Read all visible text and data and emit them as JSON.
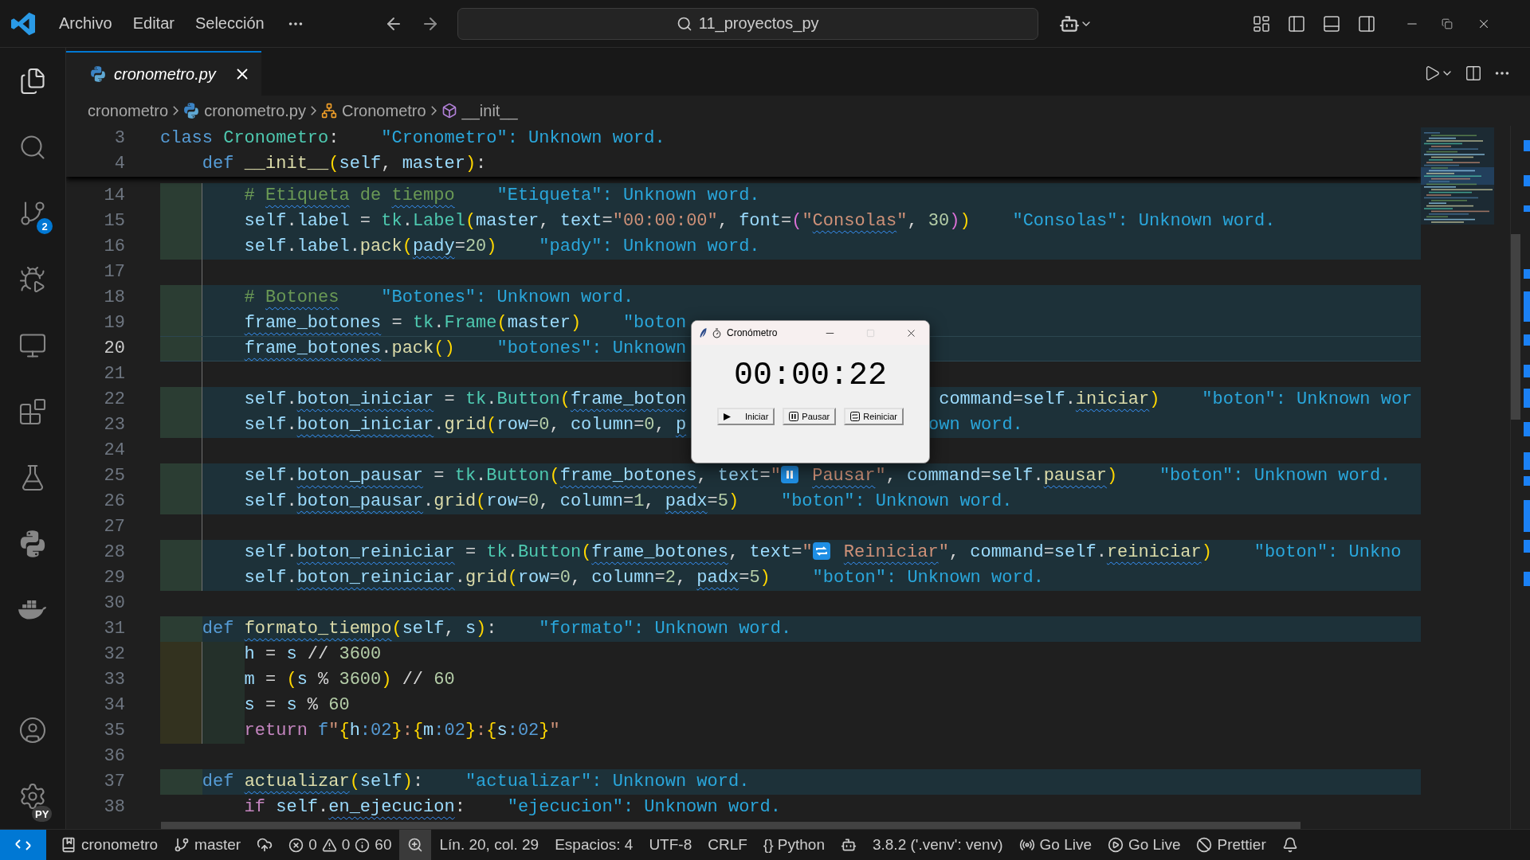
{
  "title_bar": {
    "menus": [
      "Archivo",
      "Editar",
      "Selección"
    ],
    "search": "11_proyectos_py"
  },
  "activity_bar": {
    "top": [
      {
        "kind": "files",
        "selected": true
      },
      {
        "kind": "search",
        "selected": false
      },
      {
        "kind": "source-control",
        "badge": "2",
        "selected": false
      },
      {
        "kind": "run-debug",
        "selected": false
      },
      {
        "kind": "remote",
        "selected": false
      },
      {
        "kind": "extensions",
        "selected": false
      },
      {
        "kind": "testing",
        "selected": false
      },
      {
        "kind": "python",
        "selected": false
      },
      {
        "kind": "docker",
        "selected": false
      }
    ],
    "bottom": [
      {
        "kind": "account",
        "selected": false
      },
      {
        "kind": "settings",
        "badge": "PY",
        "selected": false
      }
    ]
  },
  "tabs": [
    {
      "label": "cronometro.py",
      "selected": true
    }
  ],
  "breadcrumbs": [
    {
      "text": "cronometro"
    },
    {
      "text": "cronometro.py",
      "kind": "file"
    },
    {
      "text": "Cronometro",
      "kind": "class"
    },
    {
      "text": "__init__",
      "kind": "method"
    }
  ],
  "editor": {
    "sticky": [
      {
        "number": "3",
        "tokens": [
          {
            "kind": "kw",
            "text": "class "
          },
          {
            "kind": "cls",
            "text": "Cronometro"
          },
          {
            "kind": "op",
            "text": ":"
          }
        ],
        "diagnostic": "\"Cronometro\": Unknown word."
      },
      {
        "number": "4",
        "tokens": [
          {
            "kind": "kw",
            "text": "    def "
          },
          {
            "kind": "fn",
            "text": "__init__"
          },
          {
            "kind": "br1",
            "text": "("
          },
          {
            "kind": "var",
            "text": "self"
          },
          {
            "kind": "op",
            "text": ", "
          },
          {
            "kind": "var",
            "text": "master"
          },
          {
            "kind": "br1",
            "text": ")"
          },
          {
            "kind": "op",
            "text": ":"
          }
        ]
      }
    ],
    "lines": [
      {
        "number": "14",
        "kind": "block",
        "guide": true,
        "tokens": [
          {
            "kind": "com",
            "text": "        # "
          },
          {
            "kind": "com",
            "text": "Etiqueta",
            "wavy": true
          },
          {
            "kind": "com",
            "text": " de "
          },
          {
            "kind": "com",
            "text": "tiempo",
            "wavy": true
          }
        ],
        "diagnostic": "\"Etiqueta\": Unknown word."
      },
      {
        "number": "15",
        "kind": "block",
        "guide": true,
        "tokens": [
          {
            "kind": "var",
            "text": "        self"
          },
          {
            "kind": "op",
            "text": "."
          },
          {
            "kind": "var",
            "text": "label"
          },
          {
            "kind": "op",
            "text": " = "
          },
          {
            "kind": "cls",
            "text": "tk"
          },
          {
            "kind": "op",
            "text": "."
          },
          {
            "kind": "cls",
            "text": "Label"
          },
          {
            "kind": "br1",
            "text": "("
          },
          {
            "kind": "var",
            "text": "master"
          },
          {
            "kind": "op",
            "text": ", "
          },
          {
            "kind": "var",
            "text": "text"
          },
          {
            "kind": "op",
            "text": "="
          },
          {
            "kind": "str",
            "text": "\"00:00:00\""
          },
          {
            "kind": "op",
            "text": ", "
          },
          {
            "kind": "var",
            "text": "font"
          },
          {
            "kind": "op",
            "text": "="
          },
          {
            "kind": "br2",
            "text": "("
          },
          {
            "kind": "str",
            "text": "\""
          },
          {
            "kind": "str",
            "text": "Consolas",
            "wavy": true
          },
          {
            "kind": "str",
            "text": "\""
          },
          {
            "kind": "op",
            "text": ", "
          },
          {
            "kind": "num",
            "text": "30"
          },
          {
            "kind": "br2",
            "text": ")"
          },
          {
            "kind": "br1",
            "text": ")"
          }
        ],
        "diagnostic": "\"Consolas\": Unknown word."
      },
      {
        "number": "16",
        "kind": "block",
        "guide": true,
        "tokens": [
          {
            "kind": "var",
            "text": "        self"
          },
          {
            "kind": "op",
            "text": "."
          },
          {
            "kind": "var",
            "text": "label"
          },
          {
            "kind": "op",
            "text": "."
          },
          {
            "kind": "fn",
            "text": "pack"
          },
          {
            "kind": "br1",
            "text": "("
          },
          {
            "kind": "var",
            "text": "pady",
            "wavy": true
          },
          {
            "kind": "op",
            "text": "="
          },
          {
            "kind": "num",
            "text": "20"
          },
          {
            "kind": "br1",
            "text": ")"
          }
        ],
        "diagnostic": "\"pady\": Unknown word."
      },
      {
        "number": "17",
        "kind": "plain",
        "guide": true
      },
      {
        "number": "18",
        "kind": "block",
        "guide": true,
        "tokens": [
          {
            "kind": "com",
            "text": "        # "
          },
          {
            "kind": "com",
            "text": "Botones",
            "wavy": true
          }
        ],
        "diagnostic": "\"Botones\": Unknown word."
      },
      {
        "number": "19",
        "kind": "block",
        "guide": true,
        "tokens": [
          {
            "kind": "var",
            "text": "        frame_botones",
            "wavy": true
          },
          {
            "kind": "op",
            "text": " = "
          },
          {
            "kind": "cls",
            "text": "tk"
          },
          {
            "kind": "op",
            "text": "."
          },
          {
            "kind": "cls",
            "text": "Frame"
          },
          {
            "kind": "br1",
            "text": "("
          },
          {
            "kind": "var",
            "text": "master"
          },
          {
            "kind": "br1",
            "text": ")"
          }
        ],
        "diagnostic": "\"boton"
      },
      {
        "number": "20",
        "kind": "block",
        "guide": true,
        "current": true,
        "tokens": [
          {
            "kind": "var",
            "text": "        frame_botones",
            "wavy": true
          },
          {
            "kind": "op",
            "text": "."
          },
          {
            "kind": "fn",
            "text": "pack"
          },
          {
            "kind": "br1",
            "text": "()"
          }
        ],
        "diagnostic": "\"botones\": Unknown"
      },
      {
        "number": "21",
        "kind": "plain",
        "guide": true
      },
      {
        "number": "22",
        "kind": "block",
        "guide": true,
        "tokens": [
          {
            "kind": "var",
            "text": "        self"
          },
          {
            "kind": "op",
            "text": "."
          },
          {
            "kind": "var",
            "text": "boton_iniciar",
            "wavy": true
          },
          {
            "kind": "op",
            "text": " = "
          },
          {
            "kind": "cls",
            "text": "tk"
          },
          {
            "kind": "op",
            "text": "."
          },
          {
            "kind": "cls",
            "text": "Button"
          },
          {
            "kind": "br1",
            "text": "("
          },
          {
            "kind": "var",
            "text": "frame_boton",
            "wavy": true
          }
        ],
        "tail": {
          "tokens": [
            {
              "kind": "var",
              "text": " command"
            },
            {
              "kind": "op",
              "text": "="
            },
            {
              "kind": "var",
              "text": "self"
            },
            {
              "kind": "op",
              "text": "."
            },
            {
              "kind": "fn",
              "text": "iniciar",
              "wavy": true
            },
            {
              "kind": "br1",
              "text": ")"
            }
          ],
          "diagnostic": "\"boton\": Unknown wor"
        }
      },
      {
        "number": "23",
        "kind": "block",
        "guide": true,
        "tokens": [
          {
            "kind": "var",
            "text": "        self"
          },
          {
            "kind": "op",
            "text": "."
          },
          {
            "kind": "var",
            "text": "boton_iniciar",
            "wavy": true
          },
          {
            "kind": "op",
            "text": "."
          },
          {
            "kind": "fn",
            "text": "grid"
          },
          {
            "kind": "br1",
            "text": "("
          },
          {
            "kind": "var",
            "text": "row"
          },
          {
            "kind": "op",
            "text": "="
          },
          {
            "kind": "num",
            "text": "0"
          },
          {
            "kind": "op",
            "text": ", "
          },
          {
            "kind": "var",
            "text": "column"
          },
          {
            "kind": "op",
            "text": "="
          },
          {
            "kind": "num",
            "text": "0"
          },
          {
            "kind": "op",
            "text": ", "
          },
          {
            "kind": "var",
            "text": "p",
            "wavy": true
          }
        ],
        "tail": {
          "diagnostic": "own word."
        }
      },
      {
        "number": "24",
        "kind": "plain",
        "guide": true
      },
      {
        "number": "25",
        "kind": "block",
        "guide": true,
        "tokens": [
          {
            "kind": "var",
            "text": "        self"
          },
          {
            "kind": "op",
            "text": "."
          },
          {
            "kind": "var",
            "text": "boton_pausar",
            "wavy": true
          },
          {
            "kind": "op",
            "text": " = "
          },
          {
            "kind": "cls",
            "text": "tk"
          },
          {
            "kind": "op",
            "text": "."
          },
          {
            "kind": "cls",
            "text": "Button"
          },
          {
            "kind": "br1",
            "text": "("
          },
          {
            "kind": "var",
            "text": "frame_botones",
            "wavy": true
          },
          {
            "kind": "op",
            "text": ", "
          },
          {
            "kind": "var",
            "text": "text"
          },
          {
            "kind": "op",
            "text": "="
          },
          {
            "kind": "str",
            "text": "\""
          },
          {
            "kind": "pause-emoji"
          },
          {
            "kind": "str",
            "text": " Pausar",
            "wavy": true
          },
          {
            "kind": "str",
            "text": "\""
          },
          {
            "kind": "op",
            "text": ", "
          },
          {
            "kind": "var",
            "text": "command"
          },
          {
            "kind": "op",
            "text": "="
          },
          {
            "kind": "var",
            "text": "self"
          },
          {
            "kind": "op",
            "text": "."
          },
          {
            "kind": "fn",
            "text": "pausar",
            "wavy": true
          },
          {
            "kind": "br1",
            "text": ")"
          }
        ],
        "diagnostic": "\"boton\": Unknown word."
      },
      {
        "number": "26",
        "kind": "block",
        "guide": true,
        "tokens": [
          {
            "kind": "var",
            "text": "        self"
          },
          {
            "kind": "op",
            "text": "."
          },
          {
            "kind": "var",
            "text": "boton_pausar",
            "wavy": true
          },
          {
            "kind": "op",
            "text": "."
          },
          {
            "kind": "fn",
            "text": "grid"
          },
          {
            "kind": "br1",
            "text": "("
          },
          {
            "kind": "var",
            "text": "row"
          },
          {
            "kind": "op",
            "text": "="
          },
          {
            "kind": "num",
            "text": "0"
          },
          {
            "kind": "op",
            "text": ", "
          },
          {
            "kind": "var",
            "text": "column"
          },
          {
            "kind": "op",
            "text": "="
          },
          {
            "kind": "num",
            "text": "1"
          },
          {
            "kind": "op",
            "text": ", "
          },
          {
            "kind": "var",
            "text": "padx",
            "wavy": true
          },
          {
            "kind": "op",
            "text": "="
          },
          {
            "kind": "num",
            "text": "5"
          },
          {
            "kind": "br1",
            "text": ")"
          }
        ],
        "diagnostic": "\"boton\": Unknown word."
      },
      {
        "number": "27",
        "kind": "plain",
        "guide": true
      },
      {
        "number": "28",
        "kind": "block",
        "guide": true,
        "tokens": [
          {
            "kind": "var",
            "text": "        self"
          },
          {
            "kind": "op",
            "text": "."
          },
          {
            "kind": "var",
            "text": "boton_reiniciar",
            "wavy": true
          },
          {
            "kind": "op",
            "text": " = "
          },
          {
            "kind": "cls",
            "text": "tk"
          },
          {
            "kind": "op",
            "text": "."
          },
          {
            "kind": "cls",
            "text": "Button"
          },
          {
            "kind": "br1",
            "text": "("
          },
          {
            "kind": "var",
            "text": "frame_botones",
            "wavy": true
          },
          {
            "kind": "op",
            "text": ", "
          },
          {
            "kind": "var",
            "text": "text"
          },
          {
            "kind": "op",
            "text": "="
          },
          {
            "kind": "str",
            "text": "\""
          },
          {
            "kind": "repeat-emoji"
          },
          {
            "kind": "str",
            "text": " Reiniciar",
            "wavy": true
          },
          {
            "kind": "str",
            "text": "\""
          },
          {
            "kind": "op",
            "text": ", "
          },
          {
            "kind": "var",
            "text": "command"
          },
          {
            "kind": "op",
            "text": "="
          },
          {
            "kind": "var",
            "text": "self"
          },
          {
            "kind": "op",
            "text": "."
          },
          {
            "kind": "fn",
            "text": "reiniciar",
            "wavy": true
          },
          {
            "kind": "br1",
            "text": ")"
          }
        ],
        "diagnostic": "\"boton\": Unkno"
      },
      {
        "number": "29",
        "kind": "block",
        "guide": true,
        "tokens": [
          {
            "kind": "var",
            "text": "        self"
          },
          {
            "kind": "op",
            "text": "."
          },
          {
            "kind": "var",
            "text": "boton_reiniciar",
            "wavy": true
          },
          {
            "kind": "op",
            "text": "."
          },
          {
            "kind": "fn",
            "text": "grid"
          },
          {
            "kind": "br1",
            "text": "("
          },
          {
            "kind": "var",
            "text": "row"
          },
          {
            "kind": "op",
            "text": "="
          },
          {
            "kind": "num",
            "text": "0"
          },
          {
            "kind": "op",
            "text": ", "
          },
          {
            "kind": "var",
            "text": "column"
          },
          {
            "kind": "op",
            "text": "="
          },
          {
            "kind": "num",
            "text": "2"
          },
          {
            "kind": "op",
            "text": ", "
          },
          {
            "kind": "var",
            "text": "padx",
            "wavy": true
          },
          {
            "kind": "op",
            "text": "="
          },
          {
            "kind": "num",
            "text": "5"
          },
          {
            "kind": "br1",
            "text": ")"
          }
        ],
        "diagnostic": "\"boton\": Unknown word."
      },
      {
        "number": "30",
        "kind": "plain"
      },
      {
        "number": "31",
        "kind": "block",
        "tokens": [
          {
            "kind": "kw",
            "text": "    def "
          },
          {
            "kind": "fn",
            "text": "formato_tiempo",
            "wavy": true
          },
          {
            "kind": "br1",
            "text": "("
          },
          {
            "kind": "var",
            "text": "self"
          },
          {
            "kind": "op",
            "text": ", "
          },
          {
            "kind": "var",
            "text": "s"
          },
          {
            "kind": "br1",
            "text": ")"
          },
          {
            "kind": "op",
            "text": ":"
          }
        ],
        "diagnostic": "\"formato\": Unknown word."
      },
      {
        "number": "32",
        "kind": "body",
        "guide": true,
        "tokens": [
          {
            "kind": "var",
            "text": "        h"
          },
          {
            "kind": "op",
            "text": " = "
          },
          {
            "kind": "var",
            "text": "s"
          },
          {
            "kind": "op",
            "text": " // "
          },
          {
            "kind": "num",
            "text": "3600"
          }
        ]
      },
      {
        "number": "33",
        "kind": "body",
        "guide": true,
        "tokens": [
          {
            "kind": "var",
            "text": "        m"
          },
          {
            "kind": "op",
            "text": " = "
          },
          {
            "kind": "br1",
            "text": "("
          },
          {
            "kind": "var",
            "text": "s"
          },
          {
            "kind": "op",
            "text": " % "
          },
          {
            "kind": "num",
            "text": "3600"
          },
          {
            "kind": "br1",
            "text": ")"
          },
          {
            "kind": "op",
            "text": " // "
          },
          {
            "kind": "num",
            "text": "60"
          }
        ]
      },
      {
        "number": "34",
        "kind": "body",
        "guide": true,
        "tokens": [
          {
            "kind": "var",
            "text": "        s"
          },
          {
            "kind": "op",
            "text": " = "
          },
          {
            "kind": "var",
            "text": "s"
          },
          {
            "kind": "op",
            "text": " % "
          },
          {
            "kind": "num",
            "text": "60"
          }
        ]
      },
      {
        "number": "35",
        "kind": "body",
        "guide": true,
        "tokens": [
          {
            "kind": "ctl",
            "text": "        return "
          },
          {
            "kind": "fmt",
            "text": "f"
          },
          {
            "kind": "str",
            "text": "\""
          },
          {
            "kind": "br1",
            "text": "{"
          },
          {
            "kind": "var",
            "text": "h"
          },
          {
            "kind": "fmt",
            "text": ":02"
          },
          {
            "kind": "br1",
            "text": "}"
          },
          {
            "kind": "str",
            "text": ":"
          },
          {
            "kind": "br1",
            "text": "{"
          },
          {
            "kind": "var",
            "text": "m"
          },
          {
            "kind": "fmt",
            "text": ":02"
          },
          {
            "kind": "br1",
            "text": "}"
          },
          {
            "kind": "str",
            "text": ":"
          },
          {
            "kind": "br1",
            "text": "{"
          },
          {
            "kind": "var",
            "text": "s"
          },
          {
            "kind": "fmt",
            "text": ":02"
          },
          {
            "kind": "br1",
            "text": "}"
          },
          {
            "kind": "str",
            "text": "\""
          }
        ]
      },
      {
        "number": "36",
        "kind": "plain"
      },
      {
        "number": "37",
        "kind": "block",
        "tokens": [
          {
            "kind": "kw",
            "text": "    def "
          },
          {
            "kind": "fn",
            "text": "actualizar",
            "wavy": true
          },
          {
            "kind": "br1",
            "text": "("
          },
          {
            "kind": "var",
            "text": "self"
          },
          {
            "kind": "br1",
            "text": ")"
          },
          {
            "kind": "op",
            "text": ":"
          }
        ],
        "diagnostic": "\"actualizar\": Unknown word."
      },
      {
        "number": "38",
        "kind": "plain",
        "tokens": [
          {
            "kind": "ctl",
            "text": "        if "
          },
          {
            "kind": "var",
            "text": "self"
          },
          {
            "kind": "op",
            "text": "."
          },
          {
            "kind": "var",
            "text": "en_ejecucion",
            "wavy": true
          },
          {
            "kind": "op",
            "text": ":"
          }
        ],
        "diagnostic": "\"ejecucion\": Unknown word."
      }
    ]
  },
  "popup": {
    "title": "Cronómetro",
    "controls": [
      {
        "kind": "minimize",
        "disabled": false
      },
      {
        "kind": "maximize",
        "disabled": true
      },
      {
        "kind": "close",
        "disabled": false
      }
    ],
    "time": "00:00:22",
    "buttons": [
      {
        "label": "Iniciar",
        "kind": "play"
      },
      {
        "label": "Pausar",
        "kind": "pause"
      },
      {
        "label": "Reiniciar",
        "kind": "repeat"
      }
    ]
  },
  "status_bar": [
    {
      "kind": "remote",
      "active": false
    },
    {
      "kind": "repo",
      "text": "cronometro",
      "active": false
    },
    {
      "kind": "branch",
      "text": "master",
      "active": false
    },
    {
      "kind": "sync",
      "active": false
    },
    {
      "kind": "problems",
      "errors": "0",
      "warnings": "0",
      "infos": "60",
      "active": false
    },
    {
      "kind": "zoom",
      "active": true
    },
    {
      "kind": "position",
      "text": "Lín. 20, col. 29",
      "active": false
    },
    {
      "kind": "indent",
      "text": "Espacios: 4",
      "active": false
    },
    {
      "kind": "encoding",
      "text": "UTF-8",
      "active": false
    },
    {
      "kind": "eol",
      "text": "CRLF",
      "active": false
    },
    {
      "kind": "language",
      "text": "{} Python",
      "active": false
    },
    {
      "kind": "copilot",
      "active": false
    },
    {
      "kind": "interpreter",
      "text": "3.8.2 ('.venv': venv)",
      "active": false
    },
    {
      "kind": "live-share",
      "text": "Go Live",
      "active": false
    },
    {
      "kind": "live-server",
      "text": "Go Live",
      "active": false
    },
    {
      "kind": "prettier",
      "text": "Prettier",
      "active": false
    },
    {
      "kind": "notifications",
      "active": false
    }
  ]
}
